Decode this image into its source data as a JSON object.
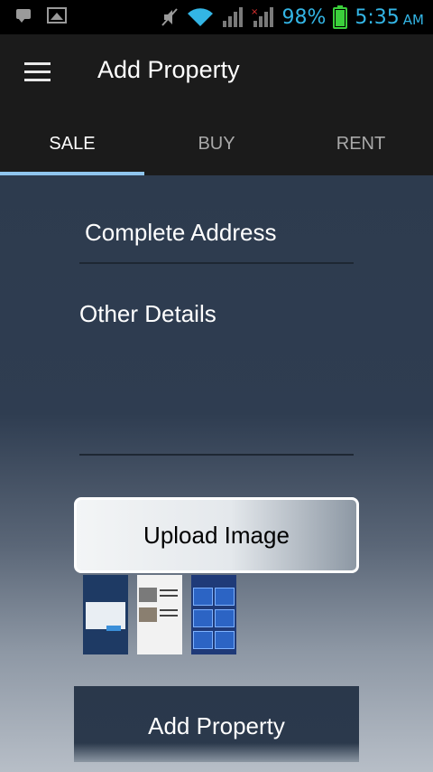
{
  "status_bar": {
    "battery": "98%",
    "time": "5:35",
    "ampm": "AM"
  },
  "app_bar": {
    "title": "Add Property",
    "menu_icon": "hamburger-menu-icon"
  },
  "tabs": [
    {
      "label": "SALE",
      "active": true
    },
    {
      "label": "BUY",
      "active": false
    },
    {
      "label": "RENT",
      "active": false
    }
  ],
  "form": {
    "address_placeholder": "Complete Address",
    "address_value": "",
    "details_placeholder": "Other Details",
    "details_value": "",
    "upload_label": "Upload Image",
    "submit_label": "Add Property"
  },
  "colors": {
    "status_accent": "#33b5e5",
    "tab_indicator": "#8fc5ee",
    "toolbar": "#1b1b1b"
  }
}
